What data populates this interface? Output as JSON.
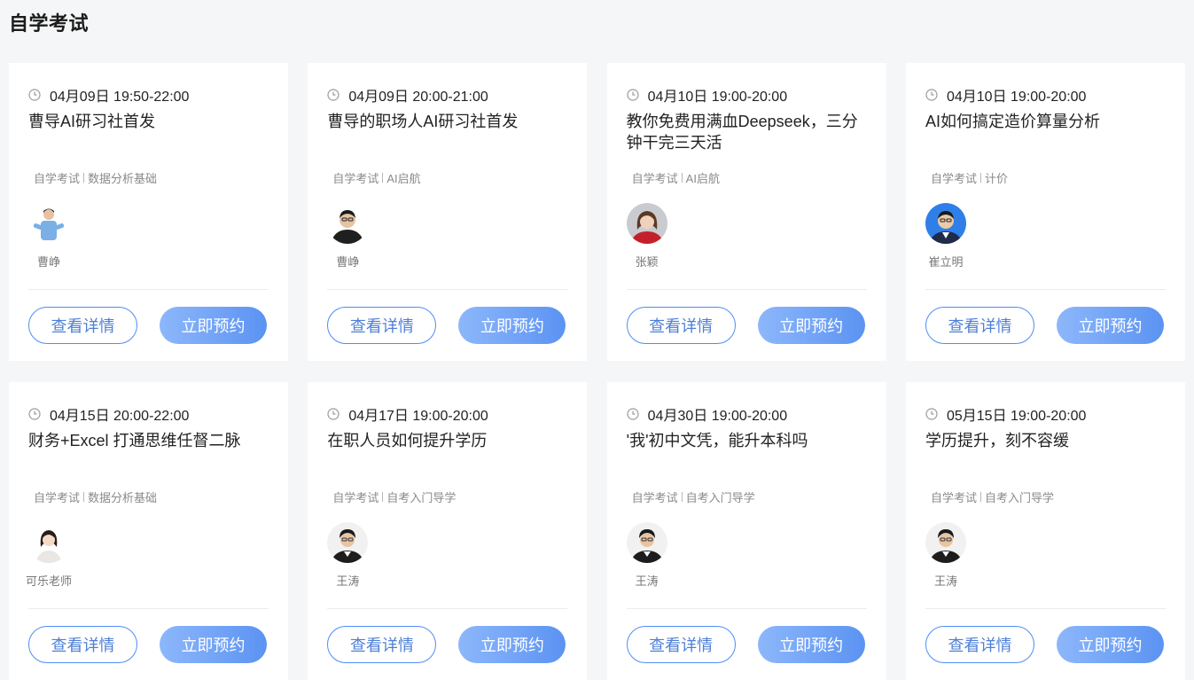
{
  "page": {
    "title": "自学考试"
  },
  "buttons": {
    "detail": "查看详情",
    "book": "立即预约"
  },
  "cards": [
    {
      "time": "04月09日 19:50-22:00",
      "title": "曹导AI研习社首发",
      "tags": [
        "自学考试",
        "数据分析基础"
      ],
      "teacher": "曹峥",
      "avatar": "teacher-cao-standing"
    },
    {
      "time": "04月09日 20:00-21:00",
      "title": "曹导的职场人AI研习社首发",
      "tags": [
        "自学考试",
        "AI启航"
      ],
      "teacher": "曹峥",
      "avatar": "teacher-cao-portrait"
    },
    {
      "time": "04月10日 19:00-20:00",
      "title": "教你免费用满血Deepseek，三分钟干完三天活",
      "tags": [
        "自学考试",
        "AI启航"
      ],
      "teacher": "张颖",
      "avatar": "teacher-zhang"
    },
    {
      "time": "04月10日 19:00-20:00",
      "title": "AI如何搞定造价算量分析",
      "tags": [
        "自学考试",
        "计价"
      ],
      "teacher": "崔立明",
      "avatar": "teacher-cui"
    },
    {
      "time": "04月15日 20:00-22:00",
      "title": "财务+Excel 打通思维任督二脉",
      "tags": [
        "自学考试",
        "数据分析基础"
      ],
      "teacher": "可乐老师",
      "avatar": "teacher-kele"
    },
    {
      "time": "04月17日 19:00-20:00",
      "title": "在职人员如何提升学历",
      "tags": [
        "自学考试",
        "自考入门导学"
      ],
      "teacher": "王涛",
      "avatar": "teacher-wang"
    },
    {
      "time": "04月30日 19:00-20:00",
      "title": "'我'初中文凭，能升本科吗",
      "tags": [
        "自学考试",
        "自考入门导学"
      ],
      "teacher": "王涛",
      "avatar": "teacher-wang"
    },
    {
      "time": "05月15日 19:00-20:00",
      "title": "学历提升，刻不容缓",
      "tags": [
        "自学考试",
        "自考入门导学"
      ],
      "teacher": "王涛",
      "avatar": "teacher-wang"
    }
  ],
  "colors": {
    "accent": "#4e8df5",
    "button_gradient_start": "#8db7fb",
    "button_gradient_end": "#5b93f2",
    "background": "#f5f6f7"
  },
  "icons": {
    "time": "clock-icon"
  }
}
